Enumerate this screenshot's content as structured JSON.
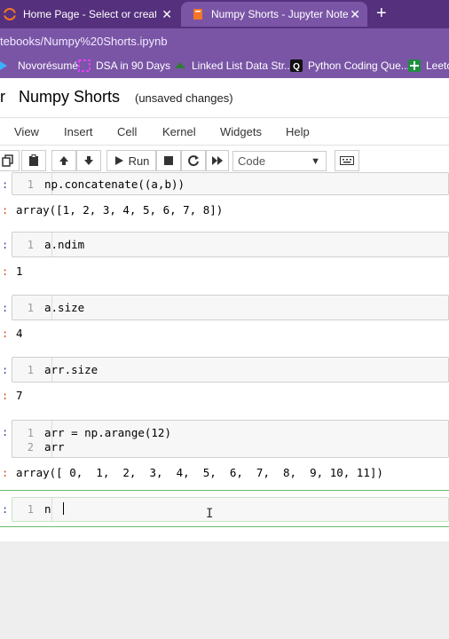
{
  "browser": {
    "tabs": [
      {
        "label": "Home Page - Select or create a n",
        "active": false
      },
      {
        "label": "Numpy Shorts - Jupyter Notebo",
        "active": true
      }
    ],
    "url": "tebooks/Numpy%20Shorts.ipynb",
    "bookmarks": [
      "Novorésumé",
      "DSA in 90 Days",
      "Linked List Data Str...",
      "Python Coding Que...",
      "Leetc"
    ]
  },
  "notebook": {
    "title_prefix": "r",
    "title": "Numpy Shorts",
    "status": "(unsaved changes)"
  },
  "menu": [
    "View",
    "Insert",
    "Cell",
    "Kernel",
    "Widgets",
    "Help"
  ],
  "toolbar": {
    "run_label": "Run",
    "cell_type": "Code"
  },
  "cells": [
    {
      "prompt": ":",
      "lines": [
        "np.concatenate((a,b))"
      ],
      "line_numbers": [
        "1"
      ],
      "output_prompt": ":",
      "output": "array([1, 2, 3, 4, 5, 6, 7, 8])"
    },
    {
      "prompt": ":",
      "lines": [
        "a.ndim"
      ],
      "line_numbers": [
        "1"
      ],
      "output_prompt": ":",
      "output": "1"
    },
    {
      "prompt": ":",
      "lines": [
        "a.size"
      ],
      "line_numbers": [
        "1"
      ],
      "output_prompt": ":",
      "output": "4"
    },
    {
      "prompt": ":",
      "lines": [
        "arr.size"
      ],
      "line_numbers": [
        "1"
      ],
      "output_prompt": ":",
      "output": "7"
    },
    {
      "prompt": ":",
      "lines": [
        "arr = np.arange(12)",
        "arr"
      ],
      "line_numbers": [
        "1",
        "2"
      ],
      "output_prompt": ":",
      "output": "array([ 0,  1,  2,  3,  4,  5,  6,  7,  8,  9, 10, 11])"
    },
    {
      "prompt": ":",
      "lines": [
        "n"
      ],
      "line_numbers": [
        "1"
      ],
      "output_prompt": "",
      "output": ""
    }
  ],
  "colors": {
    "browser_dark": "#55307d",
    "browser_light": "#7a55a6",
    "prompt_in": "#303f9f",
    "prompt_out": "#d84315"
  }
}
